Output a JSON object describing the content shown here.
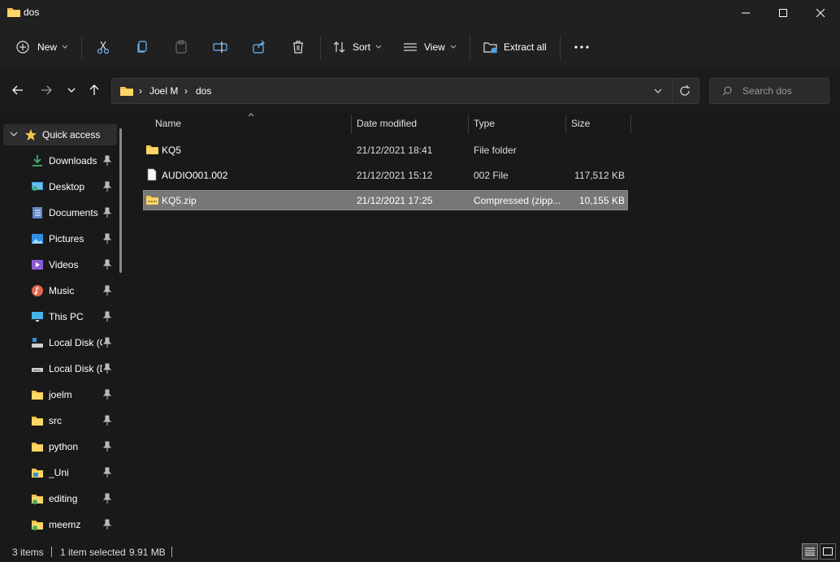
{
  "window": {
    "title": "dos"
  },
  "toolbar": {
    "new_label": "New",
    "sort_label": "Sort",
    "view_label": "View",
    "extract_label": "Extract all"
  },
  "address": {
    "crumbs": [
      "Joel M",
      "dos"
    ],
    "search_placeholder": "Search dos"
  },
  "sidebar": {
    "items": [
      {
        "label": "Quick access",
        "icon": "star-icon"
      },
      {
        "label": "Downloads",
        "icon": "download-icon"
      },
      {
        "label": "Desktop",
        "icon": "desktop-icon"
      },
      {
        "label": "Documents",
        "icon": "documents-icon"
      },
      {
        "label": "Pictures",
        "icon": "pictures-icon"
      },
      {
        "label": "Videos",
        "icon": "videos-icon"
      },
      {
        "label": "Music",
        "icon": "music-icon"
      },
      {
        "label": "This PC",
        "icon": "monitor-icon"
      },
      {
        "label": "Local Disk (C",
        "icon": "drive-icon"
      },
      {
        "label": "Local Disk (D",
        "icon": "drive-icon"
      },
      {
        "label": "joelm",
        "icon": "folder-icon"
      },
      {
        "label": "src",
        "icon": "folder-icon"
      },
      {
        "label": "python",
        "icon": "folder-icon"
      },
      {
        "label": "_Uni",
        "icon": "folder-icon"
      },
      {
        "label": "editing",
        "icon": "folder-icon"
      },
      {
        "label": "meemz",
        "icon": "folder-icon"
      }
    ]
  },
  "columns": {
    "name": "Name",
    "date": "Date modified",
    "type": "Type",
    "size": "Size"
  },
  "files": [
    {
      "name": "KQ5",
      "date": "21/12/2021 18:41",
      "type": "File folder",
      "size": "",
      "icon": "folder-icon"
    },
    {
      "name": "AUDIO001.002",
      "date": "21/12/2021 15:12",
      "type": "002 File",
      "size": "117,512 KB",
      "icon": "file-icon"
    },
    {
      "name": "KQ5.zip",
      "date": "21/12/2021 17:25",
      "type": "Compressed (zipp...",
      "size": "10,155 KB",
      "icon": "zip-folder-icon"
    }
  ],
  "status": {
    "count": "3 items",
    "selection": "1 item selected",
    "selection_size": "9.91 MB"
  },
  "colors": {
    "folder": "#f3c34a",
    "accent": "#4aa3e8",
    "selected_row": "#777777"
  }
}
